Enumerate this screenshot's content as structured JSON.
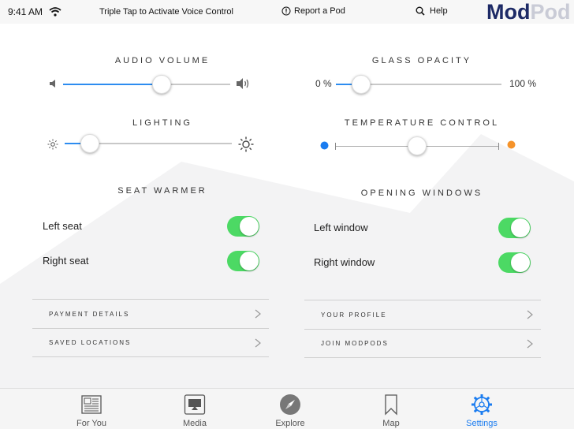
{
  "status_bar": {
    "time": "9:41 AM",
    "voice_hint": "Triple Tap to Activate Voice Control",
    "report": "Report a Pod",
    "help": "Help",
    "logo_left": "Mod",
    "logo_right": "Pod"
  },
  "audio_volume": {
    "label": "AUDIO VOLUME",
    "value_fraction": 0.59
  },
  "glass_opacity": {
    "label": "GLASS OPACITY",
    "min_label": "0 %",
    "max_label": "100 %",
    "value_fraction": 0.15
  },
  "lighting": {
    "label": "LIGHTING",
    "value_fraction": 0.15
  },
  "temperature": {
    "label": "TEMPERATURE CONTROL",
    "value_fraction": 0.5,
    "cold_color": "#1a7cf0",
    "hot_color": "#f5932a"
  },
  "seat_warmer": {
    "label": "SEAT WARMER",
    "rows": [
      {
        "label": "Left seat",
        "on": true
      },
      {
        "label": "Right seat",
        "on": true
      }
    ]
  },
  "opening_windows": {
    "label": "OPENING WINDOWS",
    "rows": [
      {
        "label": "Left window",
        "on": true
      },
      {
        "label": "Right window",
        "on": true
      }
    ]
  },
  "left_menu": [
    {
      "label": "PAYMENT DETAILS"
    },
    {
      "label": "SAVED LOCATIONS"
    }
  ],
  "right_menu": [
    {
      "label": "YOUR PROFILE"
    },
    {
      "label": "JOIN MODPODS"
    }
  ],
  "tabs": [
    {
      "label": "For You",
      "icon": "news-icon",
      "active": false
    },
    {
      "label": "Media",
      "icon": "screen-icon",
      "active": false
    },
    {
      "label": "Explore",
      "icon": "compass-icon",
      "active": false
    },
    {
      "label": "Map",
      "icon": "bookmark-icon",
      "active": false
    },
    {
      "label": "Settings",
      "icon": "gear-icon",
      "active": true
    }
  ],
  "colors": {
    "accent": "#1a7cf0",
    "toggle_on": "#4cd964"
  }
}
